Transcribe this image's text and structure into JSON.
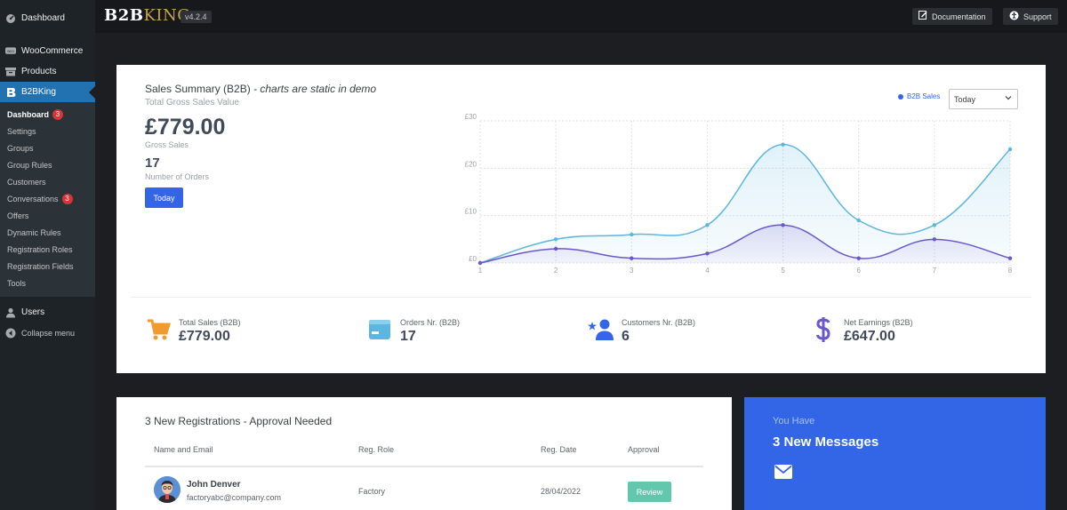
{
  "sidebar": {
    "top": [
      {
        "label": "Dashboard",
        "icon": "dashboard-gauge-icon"
      },
      {
        "label": "WooCommerce",
        "icon": "woocommerce-icon"
      },
      {
        "label": "Products",
        "icon": "archive-box-icon"
      },
      {
        "label": "B2BKing",
        "icon": "b2bking-icon"
      }
    ],
    "submenu": [
      {
        "label": "Dashboard",
        "badge": "3"
      },
      {
        "label": "Settings"
      },
      {
        "label": "Groups"
      },
      {
        "label": "Group Rules"
      },
      {
        "label": "Customers"
      },
      {
        "label": "Conversations",
        "badge": "3"
      },
      {
        "label": "Offers"
      },
      {
        "label": "Dynamic Rules"
      },
      {
        "label": "Registration Roles"
      },
      {
        "label": "Registration Fields"
      },
      {
        "label": "Tools"
      }
    ],
    "bottom": [
      {
        "label": "Users",
        "icon": "users-icon"
      },
      {
        "label": "Collapse menu",
        "icon": "collapse-arrow-icon"
      }
    ]
  },
  "topbar": {
    "logo_main": "B2B",
    "logo_accent": "KING",
    "version": "v4.2.4",
    "documentation": "Documentation",
    "support": "Support"
  },
  "summary": {
    "title": "Sales Summary (B2B)",
    "title_note": "- charts are static in demo",
    "subtitle": "Total Gross Sales Value",
    "gross_amount": "£779.00",
    "gross_label": "Gross Sales",
    "orders": "17",
    "orders_label": "Number of Orders",
    "today_button": "Today",
    "legend_label": "B2B Sales",
    "period_select": "Today"
  },
  "chart_data": {
    "type": "area",
    "x": [
      1,
      2,
      3,
      4,
      5,
      6,
      7,
      8
    ],
    "series": [
      {
        "name": "B2B Sales",
        "values": [
          0,
          5,
          6,
          8,
          25,
          9,
          8,
          24
        ],
        "color": "#5bb6e0"
      },
      {
        "values": [
          0,
          3,
          1,
          2,
          8,
          1,
          5,
          1
        ],
        "color": "#6b57c9"
      }
    ],
    "yticks": [
      "£0",
      "£10",
      "£20",
      "£30"
    ],
    "ylim": [
      0,
      30
    ],
    "grid": true,
    "legend_position": "top-right"
  },
  "stats": [
    {
      "label": "Total Sales (B2B)",
      "value": "£779.00",
      "icon": "shopping-cart-icon",
      "color": "#f29a2e"
    },
    {
      "label": "Orders Nr. (B2B)",
      "value": "17",
      "icon": "wallet-icon",
      "color": "#5bb6e0"
    },
    {
      "label": "Customers Nr. (B2B)",
      "value": "6",
      "icon": "user-star-icon",
      "color": "#3366e6"
    },
    {
      "label": "Net Earnings (B2B)",
      "value": "£647.00",
      "icon": "dollar-icon",
      "color": "#6b57c9"
    }
  ],
  "registrations": {
    "title": "3 New Registrations - Approval Needed",
    "columns": [
      "Name and Email",
      "Reg. Role",
      "Reg. Date",
      "Approval"
    ],
    "rows": [
      {
        "name": "John Denver",
        "email": "factoryabc@company.com",
        "role": "Factory",
        "date": "28/04/2022",
        "action": "Review"
      }
    ]
  },
  "messages": {
    "subtitle": "You Have",
    "title": "3 New Messages",
    "icon": "envelope-icon"
  }
}
